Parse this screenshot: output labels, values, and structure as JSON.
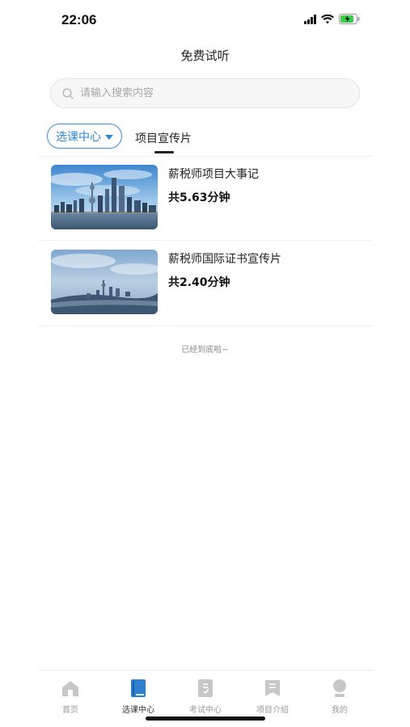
{
  "status": {
    "time": "22:06"
  },
  "header": {
    "title": "免费试听"
  },
  "search": {
    "placeholder": "请输入搜索内容"
  },
  "filter": {
    "selected": "选课中心",
    "tab_label": "项目宣传片"
  },
  "videos": [
    {
      "title": "薪税师项目大事记",
      "duration": "共5.63分钟"
    },
    {
      "title": "薪税师国际证书宣传片",
      "duration": "共2.40分钟"
    }
  ],
  "list_end": "已经到底啦~",
  "tabbar": {
    "items": [
      {
        "label": "首页",
        "icon": "home-icon"
      },
      {
        "label": "选课中心",
        "icon": "book-icon"
      },
      {
        "label": "考试中心",
        "icon": "exam-icon"
      },
      {
        "label": "项目介绍",
        "icon": "intro-icon"
      },
      {
        "label": "我的",
        "icon": "profile-icon"
      }
    ]
  },
  "colors": {
    "accent": "#2f86d6",
    "inactive_icon": "#c7c7c7"
  }
}
